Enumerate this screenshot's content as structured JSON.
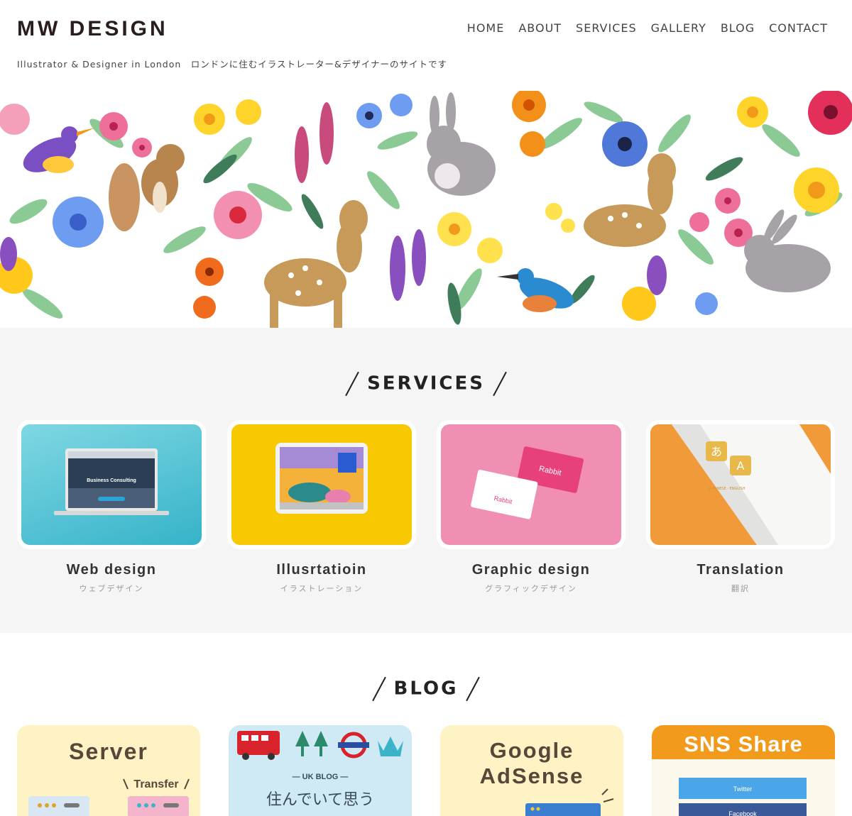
{
  "header": {
    "logo": "MW DESIGN",
    "tagline": "Illustrator & Designer in London　ロンドンに住むイラストレーター&デザイナーのサイトです",
    "nav": [
      "HOME",
      "ABOUT",
      "SERVICES",
      "GALLERY",
      "BLOG",
      "CONTACT"
    ]
  },
  "services": {
    "title": "SERVICES",
    "items": [
      {
        "title": "Web design",
        "subtitle": "ウェブデザイン",
        "image_text": "Business Consulting"
      },
      {
        "title": "Illusrtatioin",
        "subtitle": "イラストレーション"
      },
      {
        "title": "Graphic design",
        "subtitle": "グラフィックデザイン",
        "image_text": "Rabbit"
      },
      {
        "title": "Translation",
        "subtitle": "翻訳",
        "image_text": "JAPANESE · ENGLISH"
      }
    ]
  },
  "blog": {
    "title": "BLOG",
    "cards": [
      {
        "headline": "Server",
        "label": "Transfer"
      },
      {
        "tag": "— UK BLOG —",
        "headline": "住んでいて思う"
      },
      {
        "headline_line1": "Google",
        "headline_line2": "AdSense"
      },
      {
        "headline": "SNS Share",
        "button1": "Twitter",
        "button2": "Facebook"
      }
    ]
  },
  "colors": {
    "services_bg": "#f5f5f5",
    "web": "#46bfd0",
    "illustration": "#f8c800",
    "graphic": "#f08fb3",
    "translation": "#f09a3a",
    "blog_yellow": "#fdf3c4",
    "blog_blue": "#cfeaf5",
    "sns_orange": "#f29a1c"
  }
}
